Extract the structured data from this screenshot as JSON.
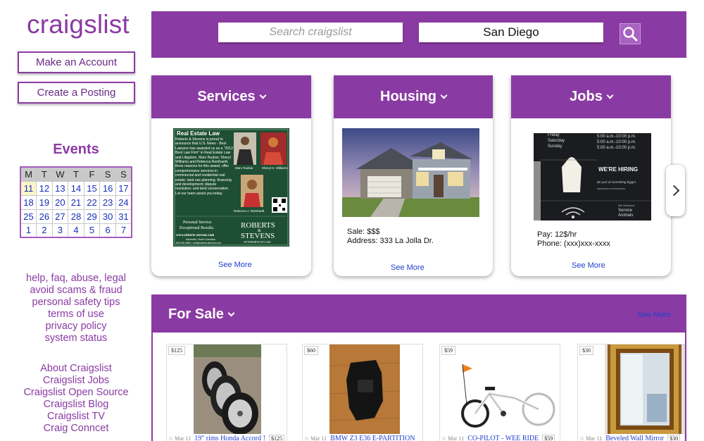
{
  "sidebar": {
    "logo": "craigslist",
    "make_account": "Make an Account",
    "create_posting": "Create a Posting",
    "events_title": "Events",
    "calendar": {
      "days": [
        "M",
        "T",
        "W",
        "T",
        "F",
        "S",
        "S"
      ],
      "weeks": [
        [
          "11",
          "12",
          "13",
          "14",
          "15",
          "16",
          "17"
        ],
        [
          "18",
          "19",
          "20",
          "21",
          "22",
          "23",
          "24"
        ],
        [
          "25",
          "26",
          "27",
          "28",
          "29",
          "30",
          "31"
        ],
        [
          "1",
          "2",
          "3",
          "4",
          "5",
          "6",
          "7"
        ]
      ]
    },
    "help_links": [
      "help, faq, abuse, legal",
      "avoid scams & fraud",
      "personal safety tips",
      "terms of use",
      "privacy policy",
      "system status"
    ],
    "about_links": [
      "About Craigslist",
      "Craigslist Jobs",
      "Craigslist Open Source",
      "Craigslist Blog",
      "Craigslist TV",
      "Craig Conncet"
    ]
  },
  "header": {
    "search_placeholder": "Search craigslist",
    "city": "San Diego"
  },
  "cards": {
    "services": {
      "title": "Services",
      "see_more": "See More",
      "ad": {
        "heading": "Real Estate Law",
        "body": "Roberts & Stevens is proud to announce that U.S. News - Best Lawyers has awarded us as a \"2012 Best Law Firm\" in Real Estate Law and Litigation. Marc Rudow, Sheryl Williams and Rebecca Reinhardt, three reasons for this award, offer comprehensive services in commercial and residential real estate; land use planning, financing and development; dispute resolution; and land conservation. Let our team assist you today.",
        "name1": "Marc Rudow",
        "name2": "Sheryl H. Williams",
        "name3": "Rebecca J. Reinhardt",
        "tagline1": "Personal Service.",
        "tagline2": "Exceptional Results.",
        "web": "www.roberts-stevens.com",
        "city": "Asheville, North Carolina",
        "contact": "828-252-6600 • info@roberts-stevens.com",
        "firm1": "ROBERTS",
        "firm2": "STEVENS",
        "firm3": "ATTORNEYS AT LAW"
      }
    },
    "housing": {
      "title": "Housing",
      "see_more": "See More",
      "sale": "Sale: $$$",
      "address": "Address: 333 La Jolla Dr."
    },
    "jobs": {
      "title": "Jobs",
      "see_more": "See More",
      "pay": "Pay: 12$/hr",
      "phone": "Phone: (xxx)xxx-xxxx",
      "sign": {
        "days": [
          "Friday",
          "Saturday",
          "Sunday"
        ],
        "hours": [
          "5:00 a.m.-10:00 p.m.",
          "5:00 a.m.-10:00 p.m.",
          "5:00 a.m.-10:00 p.m."
        ],
        "hiring": "WE'RE HIRING",
        "sub": "Be part of something bigger",
        "url": "starbucks.com/careers",
        "welcome": "We Welcome",
        "service": "Service",
        "animals": "Animals"
      }
    }
  },
  "for_sale": {
    "title": "For Sale",
    "see_more": "See More",
    "items": [
      {
        "price": "$125",
        "date": "Mar 11",
        "title": "19\" rims Honda Accord !",
        "tag": "$125"
      },
      {
        "price": "$60",
        "date": "Mar 11",
        "title": "BMW Z3 E36 E-PARTITION",
        "tag": ""
      },
      {
        "price": "$59",
        "date": "Mar 11",
        "title": "CO-PILOT - WEE RIDE",
        "tag": "$59"
      },
      {
        "price": "$30",
        "date": "Mar 11",
        "title": "Beveled Wall Mirror",
        "tag": "$30"
      }
    ]
  },
  "colors": {
    "brand": "#8a3ba3",
    "link": "#1f3ecf"
  }
}
